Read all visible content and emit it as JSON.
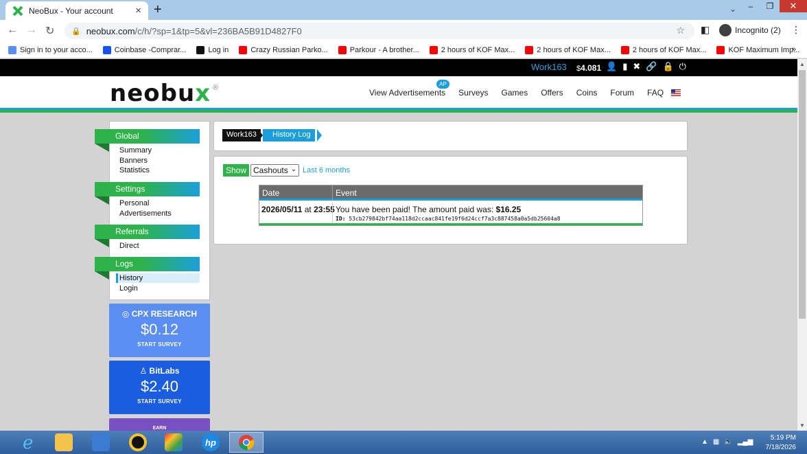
{
  "browser": {
    "tab_title": "NeoBux - Your account",
    "tab_close": "×",
    "new_tab": "+",
    "url_domain": "neobux.com",
    "url_path": "/c/h/?sp=1&tp=5&vl=236BA5B91D4827F0",
    "profile_label": "Incognito (2)",
    "bookmarks": [
      {
        "label": "Sign in to your acco...",
        "color": "#5b8ef2"
      },
      {
        "label": "Coinbase -Comprar...",
        "color": "#1652f0"
      },
      {
        "label": "Log in",
        "color": "#111111"
      },
      {
        "label": "Crazy Russian Parko...",
        "color": "#ff0000"
      },
      {
        "label": "Parkour - A brother...",
        "color": "#ff0000"
      },
      {
        "label": "2 hours of KOF Max...",
        "color": "#ff0000"
      },
      {
        "label": "2 hours of KOF Max...",
        "color": "#ff0000"
      },
      {
        "label": "2 hours of KOF Max...",
        "color": "#ff0000"
      },
      {
        "label": "KOF Maximum Imp...",
        "color": "#ff0000"
      }
    ],
    "bookmarks_more": "»"
  },
  "topbar": {
    "username": "Work163",
    "balance_currency": "$",
    "balance_value": "4.081"
  },
  "header": {
    "logo_text": "neobu",
    "logo_x": "x",
    "logo_reg": "®",
    "nav": [
      "View Advertisements",
      "Surveys",
      "Games",
      "Offers",
      "Coins",
      "Forum",
      "FAQ"
    ],
    "ap_badge": "AP"
  },
  "sidebar": {
    "sections": [
      {
        "title": "Global",
        "links": [
          "Summary",
          "Banners",
          "Statistics"
        ]
      },
      {
        "title": "Settings",
        "links": [
          "Personal",
          "Advertisements"
        ]
      },
      {
        "title": "Referrals",
        "links": [
          "Direct"
        ]
      },
      {
        "title": "Logs",
        "links": [
          "History",
          "Login"
        ]
      }
    ],
    "active_link": "History"
  },
  "promos": [
    {
      "brand": "CPX RESEARCH",
      "amount": "$0.12",
      "cta": "START SURVEY"
    },
    {
      "brand": "BitLabs",
      "amount": "$2.40",
      "cta": "START SURVEY"
    },
    {
      "brand": "EARN"
    }
  ],
  "breadcrumb": {
    "user": "Work163",
    "page": "History Log"
  },
  "filter": {
    "show_label": "Show",
    "select_value": "Cashouts",
    "range_label": "Last 6 months"
  },
  "table": {
    "headers": [
      "Date",
      "Event"
    ],
    "rows": [
      {
        "date": "2026/05/11",
        "at": "at",
        "time": "23:55",
        "event_text": "You have been paid! The amount paid was: ",
        "event_amount": "$16.25",
        "id_label": "ID:",
        "id_value": "53cb279842bf74aa118d2ccaac841fe19f6d24ccf7a3c887458a0a5db25604a8"
      }
    ]
  },
  "taskbar": {
    "time": "5:19 PM",
    "date": "7/18/2026"
  },
  "colors": {
    "neobux_green": "#2db34a",
    "neobux_blue": "#1b9fdc"
  }
}
